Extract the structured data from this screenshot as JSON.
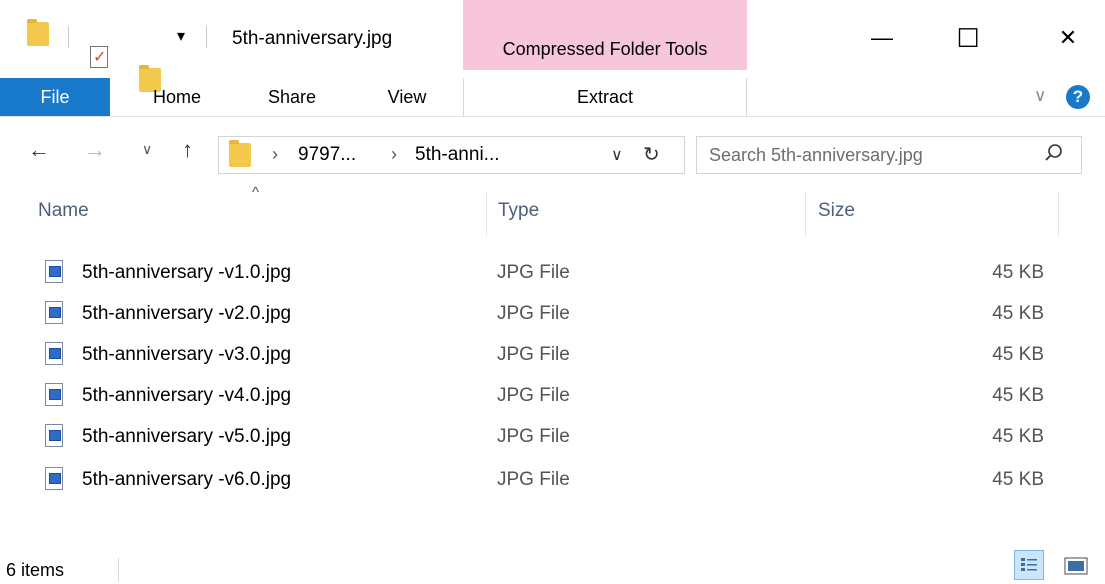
{
  "window": {
    "title": "5th-anniversary.jpg",
    "contextual_tab_group": "Compressed Folder Tools",
    "minimize_symbol": "—",
    "maximize_symbol": "☐",
    "close_symbol": "✕"
  },
  "ribbon": {
    "tabs": [
      {
        "label": "File"
      },
      {
        "label": "Home"
      },
      {
        "label": "Share"
      },
      {
        "label": "View"
      },
      {
        "label": "Extract"
      }
    ],
    "expand_symbol": "∨",
    "help_symbol": "?"
  },
  "address_bar": {
    "breadcrumb": [
      {
        "label": "9797..."
      },
      {
        "label": "5th-anni..."
      }
    ],
    "separator": "›"
  },
  "search": {
    "placeholder": "Search 5th-anniversary.jpg"
  },
  "columns": {
    "name": "Name",
    "type": "Type",
    "size": "Size",
    "sort_indicator": "^"
  },
  "files": [
    {
      "name": "5th-anniversary -v1.0.jpg",
      "type": "JPG File",
      "size": "45 KB"
    },
    {
      "name": "5th-anniversary -v2.0.jpg",
      "type": "JPG File",
      "size": "45 KB"
    },
    {
      "name": "5th-anniversary -v3.0.jpg",
      "type": "JPG File",
      "size": "45 KB"
    },
    {
      "name": "5th-anniversary -v4.0.jpg",
      "type": "JPG File",
      "size": "45 KB"
    },
    {
      "name": "5th-anniversary -v5.0.jpg",
      "type": "JPG File",
      "size": "45 KB"
    },
    {
      "name": "5th-anniversary -v6.0.jpg",
      "type": "JPG File",
      "size": "45 KB"
    }
  ],
  "status": {
    "item_count": "6 items"
  },
  "colors": {
    "file_tab": "#1979ca",
    "context_tab": "#f7c6db",
    "header_text": "#4c607a",
    "help_icon": "#1979ca"
  },
  "icons": {
    "title_folder": "folder-icon",
    "properties": "properties-check-icon",
    "new_folder": "new-folder-icon",
    "qat_dropdown": "customize-quick-access-icon",
    "back": "back-arrow-icon",
    "forward": "forward-arrow-icon",
    "recent": "recent-locations-chevron-icon",
    "up": "up-arrow-icon",
    "refresh": "refresh-icon",
    "search": "search-icon",
    "file": "jpg-file-icon",
    "details_view": "details-view-icon",
    "large_icons_view": "large-icons-view-icon"
  }
}
